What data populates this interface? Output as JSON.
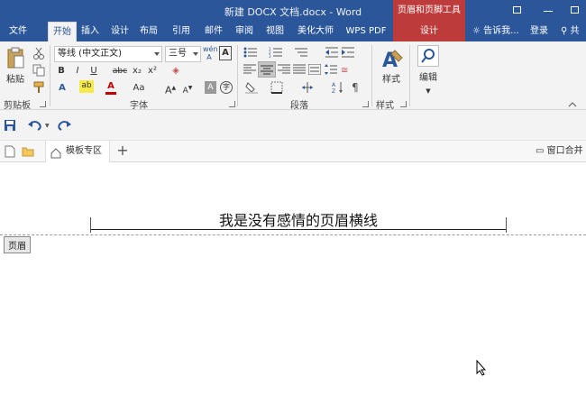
{
  "window": {
    "title": "新建 DOCX 文档.docx - Word",
    "context_tool_title": "页眉和页脚工具"
  },
  "tabs": [
    {
      "label": "文件"
    },
    {
      "label": "开始"
    },
    {
      "label": "插入"
    },
    {
      "label": "设计"
    },
    {
      "label": "布局"
    },
    {
      "label": "引用"
    },
    {
      "label": "邮件"
    },
    {
      "label": "审阅"
    },
    {
      "label": "视图"
    },
    {
      "label": "美化大师"
    },
    {
      "label": "WPS PDF"
    },
    {
      "label": "设计"
    }
  ],
  "tell_me": "告诉我...",
  "login": "登录",
  "share": "共",
  "ribbon": {
    "clipboard": {
      "paste_label": "粘贴",
      "group_label": "剪贴板"
    },
    "font": {
      "font_name": "等线 (中文正文)",
      "font_size": "三号",
      "group_label": "字体",
      "bold": "B",
      "italic": "I",
      "underline": "U",
      "strike": "abc",
      "sub": "x₂",
      "sup": "x²",
      "aa": "Aa"
    },
    "paragraph": {
      "group_label": "段落"
    },
    "styles": {
      "label": "样式",
      "group_label": "样式"
    },
    "editing": {
      "label": "编辑"
    }
  },
  "doctabs": {
    "template_zone": "模板专区",
    "add": "+",
    "window_merge": "窗口合并"
  },
  "document": {
    "header_text": "我是没有感情的页眉横线",
    "header_tag": "页眉"
  }
}
